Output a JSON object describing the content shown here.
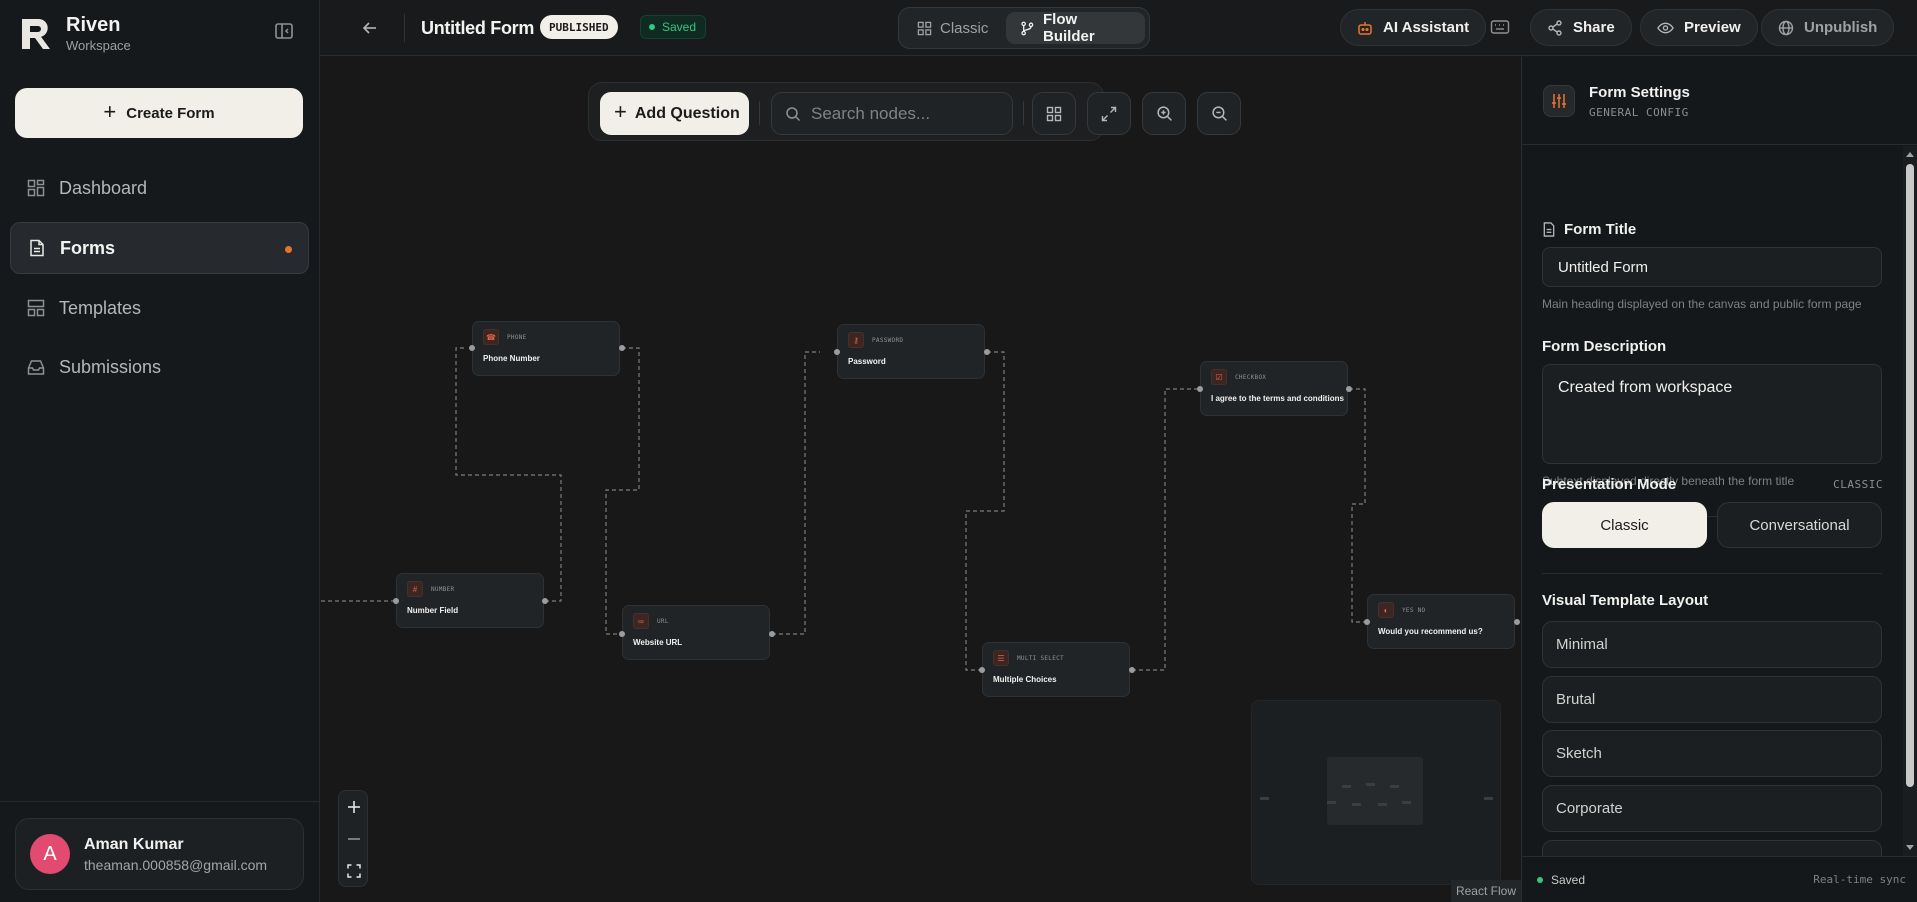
{
  "sidebar": {
    "brand": {
      "name": "Riven",
      "subtitle": "Workspace"
    },
    "create_label": "Create Form",
    "nav": [
      {
        "label": "Dashboard",
        "icon": "dashboard-icon"
      },
      {
        "label": "Forms",
        "icon": "document-icon",
        "active": true,
        "badge": "unread-dot"
      },
      {
        "label": "Templates",
        "icon": "templates-icon"
      },
      {
        "label": "Submissions",
        "icon": "inbox-icon"
      }
    ],
    "user": {
      "initial": "A",
      "name": "Aman Kumar",
      "email": "theaman.000858@gmail.com",
      "avatar_color": "#e34a6f"
    }
  },
  "topbar": {
    "form_title": "Untitled Form",
    "status_badge": "PUBLISHED",
    "save_status": "Saved",
    "view_modes": [
      "Classic",
      "Flow Builder"
    ],
    "active_view": "Flow Builder",
    "ai_label": "AI Assistant",
    "share_label": "Share",
    "preview_label": "Preview",
    "unpublish_label": "Unpublish"
  },
  "canvas": {
    "toolbar": {
      "add_label": "Add Question",
      "search_placeholder": "Search nodes..."
    },
    "nodes": [
      {
        "type": "NUMBER",
        "label": "Number Field"
      },
      {
        "type": "PHONE",
        "label": "Phone Number"
      },
      {
        "type": "URL",
        "label": "Website URL"
      },
      {
        "type": "PASSWORD",
        "label": "Password"
      },
      {
        "type": "MULTI SELECT",
        "label": "Multiple Choices"
      },
      {
        "type": "CHECKBOX",
        "label": "I agree to the terms and conditions"
      },
      {
        "type": "YES NO",
        "label": "Would you recommend us?"
      }
    ],
    "attribution": "React Flow"
  },
  "panel": {
    "title": "Form Settings",
    "subtitle": "GENERAL CONFIG",
    "form_title_label": "Form Title",
    "form_title_value": "Untitled Form",
    "form_title_hint": "Main heading displayed on the canvas and public form page",
    "desc_label": "Form Description",
    "desc_value": "Created from workspace",
    "desc_hint": "Subtext displayed directly beneath the form title",
    "presentation_label": "Presentation Mode",
    "presentation_tag": "CLASSIC",
    "modes": [
      "Classic",
      "Conversational"
    ],
    "active_mode": "Classic",
    "layout_label": "Visual Template Layout",
    "layouts": [
      "Minimal",
      "Brutal",
      "Sketch",
      "Corporate"
    ],
    "footer_status": "Saved",
    "footer_right": "Real-time sync"
  },
  "colors": {
    "accent": "#e8742c",
    "success": "#35c684",
    "node_icon": "#e0624a",
    "button_light": "#f1efe8"
  }
}
